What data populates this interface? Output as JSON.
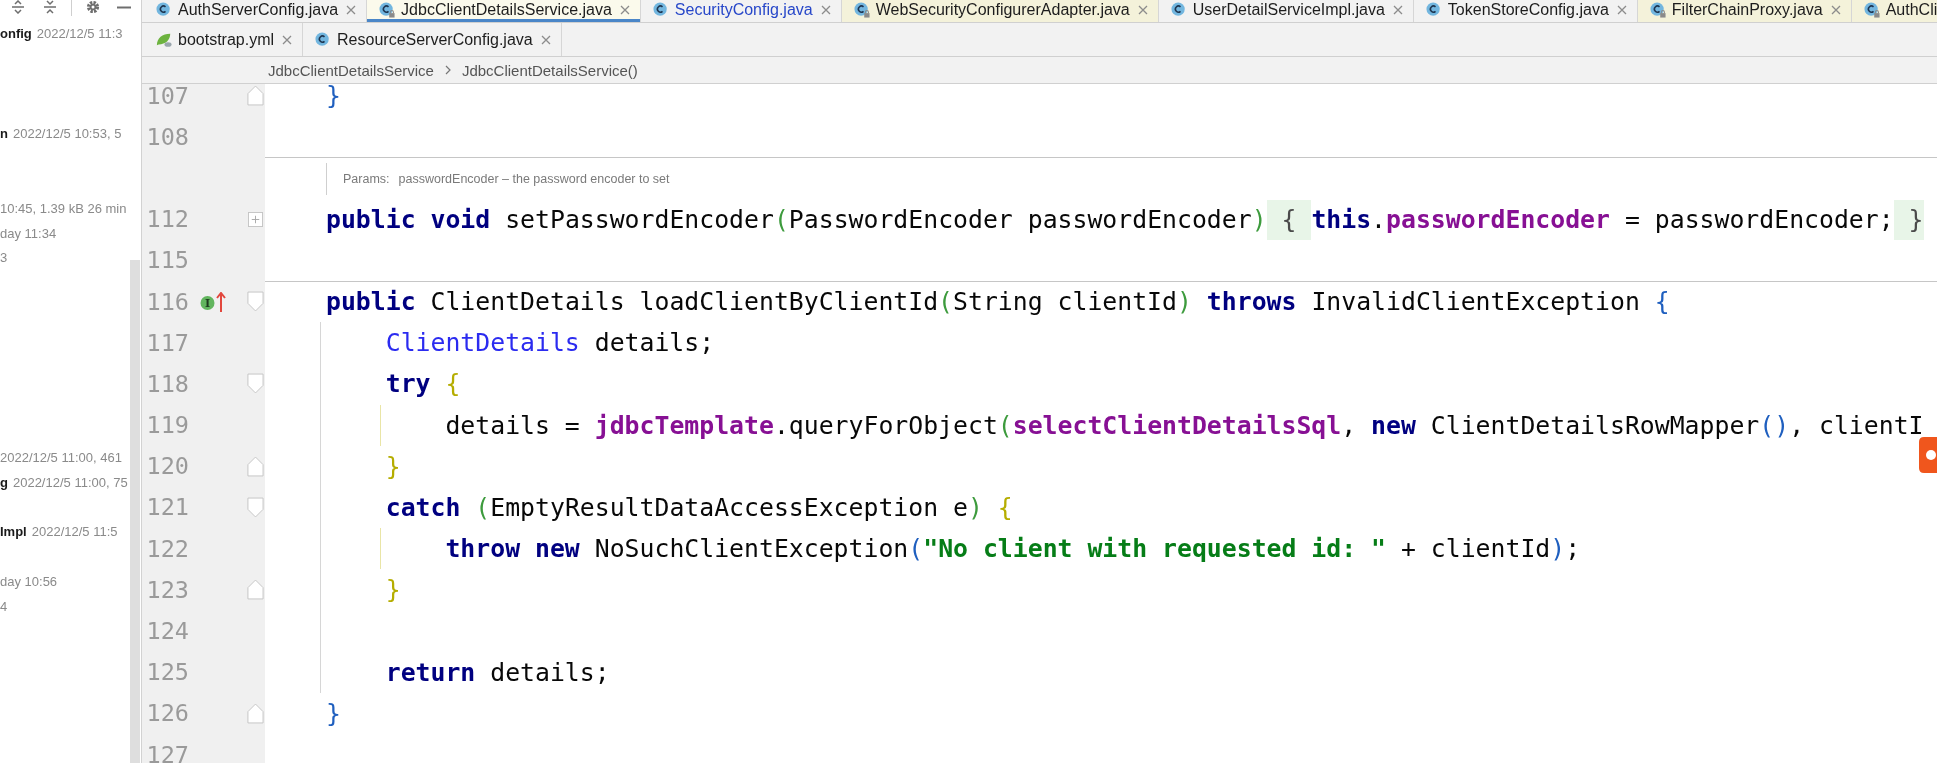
{
  "file_panel": {
    "rows": [
      {
        "name": "onfig",
        "meta": "2022/12/5 11:3"
      },
      {
        "name": "n",
        "meta": "2022/12/5 10:53, 5"
      },
      {
        "meta": "10:45, 1.39 kB 26 min"
      },
      {
        "meta": "day 11:34"
      },
      {
        "meta": "3"
      },
      {
        "meta": "2022/12/5 11:00, 461"
      },
      {
        "name": "g",
        "meta": "2022/12/5 11:00, 75"
      },
      {
        "name": "Impl",
        "meta": "2022/12/5 11:5"
      },
      {
        "meta": "day 10:56"
      },
      {
        "meta": "4"
      }
    ]
  },
  "tab_rows": [
    {
      "tabs": [
        {
          "label": "AuthServerConfig.java",
          "kind": "class",
          "library": false,
          "modified": false,
          "selected": false,
          "closable": true
        },
        {
          "label": "JdbcClientDetailsService.java",
          "kind": "class",
          "library": true,
          "modified": false,
          "selected": true,
          "closable": true
        },
        {
          "label": "SecurityConfig.java",
          "kind": "class",
          "library": false,
          "modified": true,
          "selected": false,
          "closable": true
        },
        {
          "label": "WebSecurityConfigurerAdapter.java",
          "kind": "class",
          "library": true,
          "modified": false,
          "selected": false,
          "closable": true
        },
        {
          "label": "UserDetailServiceImpl.java",
          "kind": "class",
          "library": false,
          "modified": false,
          "selected": false,
          "closable": true
        },
        {
          "label": "TokenStoreConfig.java",
          "kind": "class",
          "library": false,
          "modified": false,
          "selected": false,
          "closable": true
        },
        {
          "label": "FilterChainProxy.java",
          "kind": "class",
          "library": true,
          "modified": false,
          "selected": false,
          "closable": true
        },
        {
          "label": "AuthCli",
          "kind": "class",
          "library": true,
          "modified": false,
          "selected": false,
          "closable": false
        }
      ]
    },
    {
      "tabs": [
        {
          "label": "bootstrap.yml",
          "kind": "spring-config",
          "library": false,
          "modified": false,
          "selected": false,
          "closable": true
        },
        {
          "label": "ResourceServerConfig.java",
          "kind": "class",
          "library": false,
          "modified": false,
          "selected": false,
          "closable": true
        }
      ]
    }
  ],
  "breadcrumbs": [
    "JdbcClientDetailsService",
    "JdbcClientDetailsService()"
  ],
  "editor": {
    "lines": [
      {
        "kind": "code",
        "number": "107",
        "fold": {
          "kind": "end"
        },
        "separator": false,
        "tokens": [
          {
            "text": "}",
            "kind": "bracket",
            "color": "#1f5fbf"
          }
        ]
      },
      {
        "kind": "code",
        "number": "108",
        "separator": false
      },
      {
        "kind": "doc",
        "separator": true,
        "label": "Params:",
        "text": "passwordEncoder – the password encoder to set"
      },
      {
        "kind": "code",
        "number": "112",
        "fold": {
          "kind": "collapsed"
        },
        "separator": false,
        "tokens": [
          {
            "text": "public ",
            "kind": "keyword"
          },
          {
            "text": "void ",
            "kind": "keyword"
          },
          {
            "text": "setPasswordEncoder",
            "kind": "plain"
          },
          {
            "text": "(",
            "kind": "bracket",
            "color": "#3d9b3d"
          },
          {
            "text": "PasswordEncoder passwordEncoder",
            "kind": "plain"
          },
          {
            "text": ")",
            "kind": "bracket",
            "color": "#3d9b3d"
          },
          {
            "text": " { ",
            "kind": "fold"
          },
          {
            "text": "this",
            "kind": "keyword"
          },
          {
            "text": ".",
            "kind": "plain"
          },
          {
            "text": "passwordEncoder ",
            "kind": "field"
          },
          {
            "text": "= passwordEncoder;",
            "kind": "plain"
          },
          {
            "text": " }",
            "kind": "fold"
          }
        ]
      },
      {
        "kind": "code",
        "number": "115",
        "separator": false
      },
      {
        "kind": "code",
        "number": "116",
        "fold": {
          "kind": "start"
        },
        "gutter_icon": {
          "kind": "implements",
          "letter": "I"
        },
        "separator": true,
        "tokens": [
          {
            "text": "public ",
            "kind": "keyword"
          },
          {
            "text": "ClientDetails loadClientByClientId",
            "kind": "plain"
          },
          {
            "text": "(",
            "kind": "bracket",
            "color": "#3d9b3d"
          },
          {
            "text": "String clientId",
            "kind": "plain"
          },
          {
            "text": ") ",
            "kind": "bracket",
            "color": "#3d9b3d"
          },
          {
            "text": "throws ",
            "kind": "keyword"
          },
          {
            "text": "InvalidClientException ",
            "kind": "plain"
          },
          {
            "text": "{",
            "kind": "bracket",
            "color": "#1f5fbf"
          }
        ],
        "children": [
          {
            "kind": "code",
            "number": "117",
            "separator": false,
            "tokens": [
              {
                "text": "ClientDetails ",
                "kind": "type"
              },
              {
                "text": "details;",
                "kind": "plain"
              }
            ]
          },
          {
            "kind": "code",
            "number": "118",
            "fold": {
              "kind": "start"
            },
            "separator": false,
            "tokens": [
              {
                "text": "try ",
                "kind": "keyword"
              },
              {
                "text": "{",
                "kind": "bracket",
                "color": "#b5ad00"
              }
            ],
            "children": [
              {
                "kind": "code",
                "number": "119",
                "separator": false,
                "tokens": [
                  {
                    "text": "details = ",
                    "kind": "plain"
                  },
                  {
                    "text": "jdbcTemplate",
                    "kind": "field"
                  },
                  {
                    "text": ".queryForObject",
                    "kind": "plain"
                  },
                  {
                    "text": "(",
                    "kind": "bracket",
                    "color": "#3d9b3d"
                  },
                  {
                    "text": "selectClientDetailsSql",
                    "kind": "field"
                  },
                  {
                    "text": ", ",
                    "kind": "plain"
                  },
                  {
                    "text": "new ",
                    "kind": "keyword"
                  },
                  {
                    "text": "ClientDetailsRowMapper",
                    "kind": "plain"
                  },
                  {
                    "text": "()",
                    "kind": "bracket",
                    "color": "#1f5fbf"
                  },
                  {
                    "text": ", clientI",
                    "kind": "plain"
                  }
                ]
              }
            ]
          },
          {
            "kind": "code",
            "number": "120",
            "fold": {
              "kind": "end"
            },
            "separator": false,
            "tokens": [
              {
                "text": "}",
                "kind": "bracket",
                "color": "#b5ad00"
              }
            ]
          },
          {
            "kind": "code",
            "number": "121",
            "fold": {
              "kind": "start"
            },
            "separator": false,
            "tokens": [
              {
                "text": "catch ",
                "kind": "keyword"
              },
              {
                "text": "(",
                "kind": "bracket",
                "color": "#3d9b3d"
              },
              {
                "text": "EmptyResultDataAccessException e",
                "kind": "plain"
              },
              {
                "text": ") ",
                "kind": "bracket",
                "color": "#3d9b3d"
              },
              {
                "text": "{",
                "kind": "bracket",
                "color": "#b5ad00"
              }
            ],
            "children": [
              {
                "kind": "code",
                "number": "122",
                "separator": false,
                "tokens": [
                  {
                    "text": "throw ",
                    "kind": "keyword"
                  },
                  {
                    "text": "new ",
                    "kind": "keyword"
                  },
                  {
                    "text": "NoSuchClientException",
                    "kind": "plain"
                  },
                  {
                    "text": "(",
                    "kind": "bracket",
                    "color": "#1f5fbf"
                  },
                  {
                    "text": "\"No client with requested id: \" ",
                    "kind": "string"
                  },
                  {
                    "text": "+ clientId",
                    "kind": "plain"
                  },
                  {
                    "text": ")",
                    "kind": "bracket",
                    "color": "#1f5fbf"
                  },
                  {
                    "text": ";",
                    "kind": "plain"
                  }
                ]
              }
            ]
          },
          {
            "kind": "code",
            "number": "123",
            "fold": {
              "kind": "end"
            },
            "separator": false,
            "tokens": [
              {
                "text": "}",
                "kind": "bracket",
                "color": "#b5ad00"
              }
            ]
          },
          {
            "kind": "code",
            "number": "124",
            "separator": false
          },
          {
            "kind": "code",
            "number": "125",
            "separator": false,
            "tokens": [
              {
                "text": "return ",
                "kind": "keyword"
              },
              {
                "text": "details;",
                "kind": "plain"
              }
            ]
          }
        ]
      },
      {
        "kind": "code",
        "number": "126",
        "fold": {
          "kind": "end"
        },
        "separator": false,
        "tokens": [
          {
            "text": "}",
            "kind": "bracket",
            "color": "#1f5fbf"
          }
        ]
      },
      {
        "kind": "code",
        "number": "127",
        "separator": false
      }
    ]
  }
}
